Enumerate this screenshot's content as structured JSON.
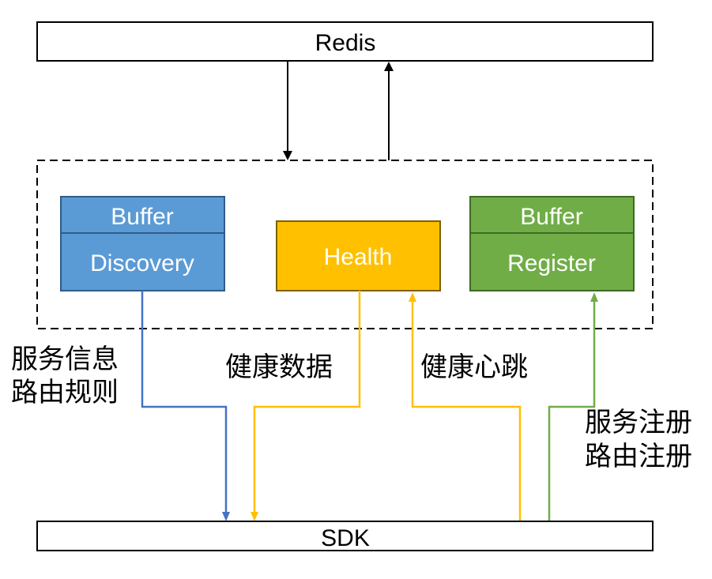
{
  "redis": {
    "label": "Redis"
  },
  "sdk": {
    "label": "SDK"
  },
  "buffer_discovery": {
    "top_label": "Buffer",
    "bottom_label": "Discovery",
    "color": "#5B9BD5",
    "border": "#2E5C8A"
  },
  "health": {
    "label": "Health",
    "color": "#FFC000",
    "border": "#7F6000"
  },
  "buffer_register": {
    "top_label": "Buffer",
    "bottom_label": "Register",
    "color": "#70AD47",
    "border": "#3D6B23"
  },
  "annotations": {
    "discovery_line1": "服务信息",
    "discovery_line2": "路由规则",
    "health_data": "健康数据",
    "heartbeat": "健康心跳",
    "register_line1": "服务注册",
    "register_line2": "路由注册"
  },
  "colors": {
    "blue_line": "#4472C4",
    "yellow_line": "#FFC000",
    "green_line": "#70AD47",
    "black_line": "#000000"
  }
}
